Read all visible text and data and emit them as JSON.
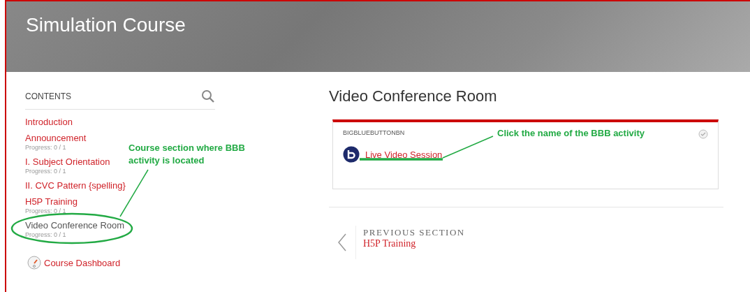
{
  "header": {
    "title": "Simulation Course"
  },
  "sidebar": {
    "heading": "CONTENTS",
    "items": [
      {
        "label": "Introduction",
        "selected": false
      },
      {
        "label": "Announcement",
        "progress": "Progress: 0 / 1",
        "selected": false
      },
      {
        "label": "I. Subject Orientation",
        "progress": "Progress: 0 / 1",
        "selected": false
      },
      {
        "label": "II. CVC Pattern {spelling}",
        "selected": false
      },
      {
        "label": "H5P Training",
        "progress": "Progress: 0 / 1",
        "selected": false
      },
      {
        "label": "Video Conference Room",
        "progress": "Progress: 0 / 1",
        "selected": true
      }
    ],
    "dashboard_link": "Course Dashboard"
  },
  "main": {
    "title": "Video Conference Room",
    "activity": {
      "type_label": "BIGBLUEBUTTONBN",
      "name": "Live Video Session",
      "completed": false
    },
    "previous": {
      "label": "PREVIOUS SECTION",
      "name": "H5P Training"
    }
  },
  "annotations": [
    {
      "text": "Course section where BBB activity is located"
    },
    {
      "text": "Click the name of the BBB activity"
    }
  ]
}
